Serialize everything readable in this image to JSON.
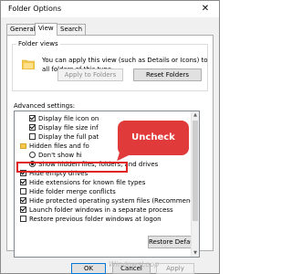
{
  "window": {
    "title": "Folder Options",
    "close_label": "✕"
  },
  "tabs": [
    {
      "label": "General"
    },
    {
      "label": "View"
    },
    {
      "label": "Search"
    }
  ],
  "folder_views": {
    "label": "Folder views",
    "description": "You can apply this view (such as Details or Icons) to all folders of this type.",
    "apply_button": "Apply to Folders",
    "reset_button": "Reset Folders"
  },
  "advanced": {
    "label": "Advanced settings:",
    "items": [
      {
        "type": "checkbox",
        "checked": true,
        "label": "Display file icon on"
      },
      {
        "type": "checkbox",
        "checked": true,
        "label": "Display file size inf"
      },
      {
        "type": "checkbox",
        "checked": false,
        "label": "Display the full pat"
      },
      {
        "type": "folder",
        "label": "Hidden files and fo"
      },
      {
        "type": "radio",
        "checked": false,
        "label": "Don't show hi"
      },
      {
        "type": "radio",
        "checked": true,
        "label": "Show hidden files, folders, and drives"
      },
      {
        "type": "checkbox",
        "checked": true,
        "label": "Hide empty drives"
      },
      {
        "type": "checkbox",
        "checked": true,
        "label": "Hide extensions for known file types"
      },
      {
        "type": "checkbox",
        "checked": false,
        "label": "Hide folder merge conflicts"
      },
      {
        "type": "checkbox",
        "checked": true,
        "label": "Hide protected operating system files (Recommended)"
      },
      {
        "type": "checkbox",
        "checked": true,
        "label": "Launch folder windows in a separate process"
      },
      {
        "type": "checkbox",
        "checked": false,
        "label": "Restore previous folder windows at logon"
      }
    ],
    "restore_button": "Restore Defaults"
  },
  "annotation": {
    "callout": "Uncheck",
    "color": "#e03a3a"
  },
  "footer": {
    "ok": "OK",
    "cancel": "Cancel",
    "apply": "Apply"
  },
  "watermark": "WindowsLoop"
}
